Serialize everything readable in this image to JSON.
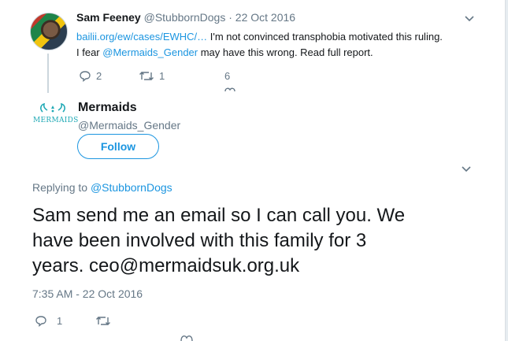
{
  "parent_tweet": {
    "display_name": "Sam Feeney",
    "handle": "@StubbornDogs",
    "separator": "·",
    "date": "22 Oct 2016",
    "link_text": "bailii.org/ew/cases/EWHC/…",
    "text_part1": " I'm not convinced transphobia motivated this ruling.",
    "text_part2": "I fear ",
    "mention": "@Mermaids_Gender",
    "text_part3": " may have this wrong. Read full report.",
    "reply_count": "2",
    "retweet_count": "1",
    "like_count": "6"
  },
  "main_tweet": {
    "logo_text": "MERMAIDS",
    "display_name": "Mermaids",
    "handle": "@Mermaids_Gender",
    "follow_label": "Follow",
    "replying_prefix": "Replying to ",
    "replying_handle": "@StubbornDogs",
    "text_line1": "Sam send me an email so I can call you. We",
    "text_line2": "have been involved with this family for 3",
    "text_line3": "years. ceo@mermaidsuk.org.uk",
    "timestamp": "7:35 AM - 22 Oct 2016",
    "reply_count": "1"
  },
  "colors": {
    "accent": "#1b95e0",
    "muted": "#657786",
    "brand_teal": "#20a9b5"
  }
}
